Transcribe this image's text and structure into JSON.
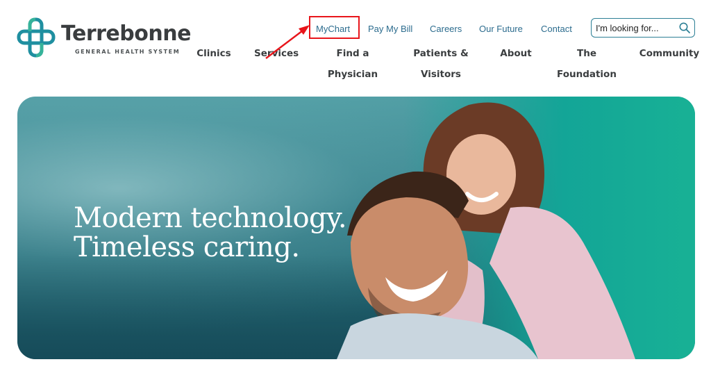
{
  "logo": {
    "name": "Terrebonne",
    "subtitle": "GENERAL HEALTH SYSTEM"
  },
  "utility_nav": [
    {
      "label": "MyChart"
    },
    {
      "label": "Pay My Bill"
    },
    {
      "label": "Careers"
    },
    {
      "label": "Our Future"
    },
    {
      "label": "Contact"
    }
  ],
  "search": {
    "placeholder": "I'm looking for...",
    "icon": "magnifier"
  },
  "main_nav": [
    {
      "line1": "Clinics",
      "line2": ""
    },
    {
      "line1": "Services",
      "line2": ""
    },
    {
      "line1": "Find a",
      "line2": "Physician"
    },
    {
      "line1": "Patients &",
      "line2": "Visitors"
    },
    {
      "line1": "About",
      "line2": ""
    },
    {
      "line1": "The",
      "line2": "Foundation"
    },
    {
      "line1": "Community",
      "line2": ""
    }
  ],
  "annotation": {
    "highlight_color": "#e8151b"
  },
  "hero": {
    "line1": "Modern technology.",
    "line2": "Timeless caring."
  },
  "colors": {
    "brand_teal": "#2c7f95",
    "link_blue": "#2c6c8e",
    "nav_text": "#3a3d3f"
  }
}
